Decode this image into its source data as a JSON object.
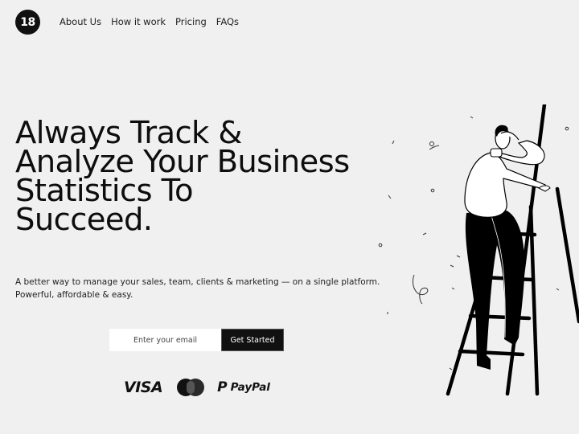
{
  "logo": {
    "text": "18"
  },
  "nav": {
    "items": [
      {
        "label": "About Us"
      },
      {
        "label": "How it work"
      },
      {
        "label": "Pricing"
      },
      {
        "label": "FAQs"
      }
    ]
  },
  "hero": {
    "headline": "Always Track &\nAnalyze Your Business\nStatistics To\nSucceed.",
    "subtitle": "A better way to manage your sales, team, clients & marketing — on a single platform. Powerful, affordable & easy."
  },
  "signup": {
    "email_placeholder": "Enter your email",
    "email_value": "",
    "button_label": "Get Started"
  },
  "payments": {
    "visa": "VISA",
    "mastercard": "mastercard-icon",
    "paypal_mark": "P",
    "paypal": "PayPal"
  },
  "illustration": {
    "subject": "man-on-ladder-icon"
  },
  "colors": {
    "background": "#f0f0f0",
    "accent": "#111111",
    "input_bg": "#ffffff"
  }
}
